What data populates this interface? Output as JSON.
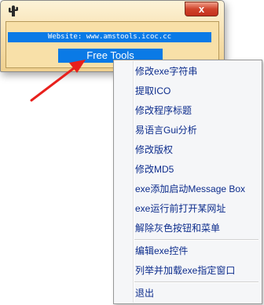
{
  "window": {
    "icon": "cactus-icon",
    "close_label": "x",
    "website": "Website: www.amstools.icoc.cc",
    "button_label": "Free Tools"
  },
  "menu": {
    "items": [
      "修改exe字符串",
      "提取ICO",
      "修改程序标题",
      "易语言Gui分析",
      "修改版权",
      "修改MD5",
      "exe添加启动Message Box",
      "exe运行前打开某网址",
      "解除灰色按钮和菜单",
      "编辑exe控件",
      "列举并加载exe指定窗口",
      "退出"
    ]
  },
  "colors": {
    "accent": "#0a7ae6",
    "menu_text": "#0c2c8c",
    "arrow": "#e8201c"
  }
}
